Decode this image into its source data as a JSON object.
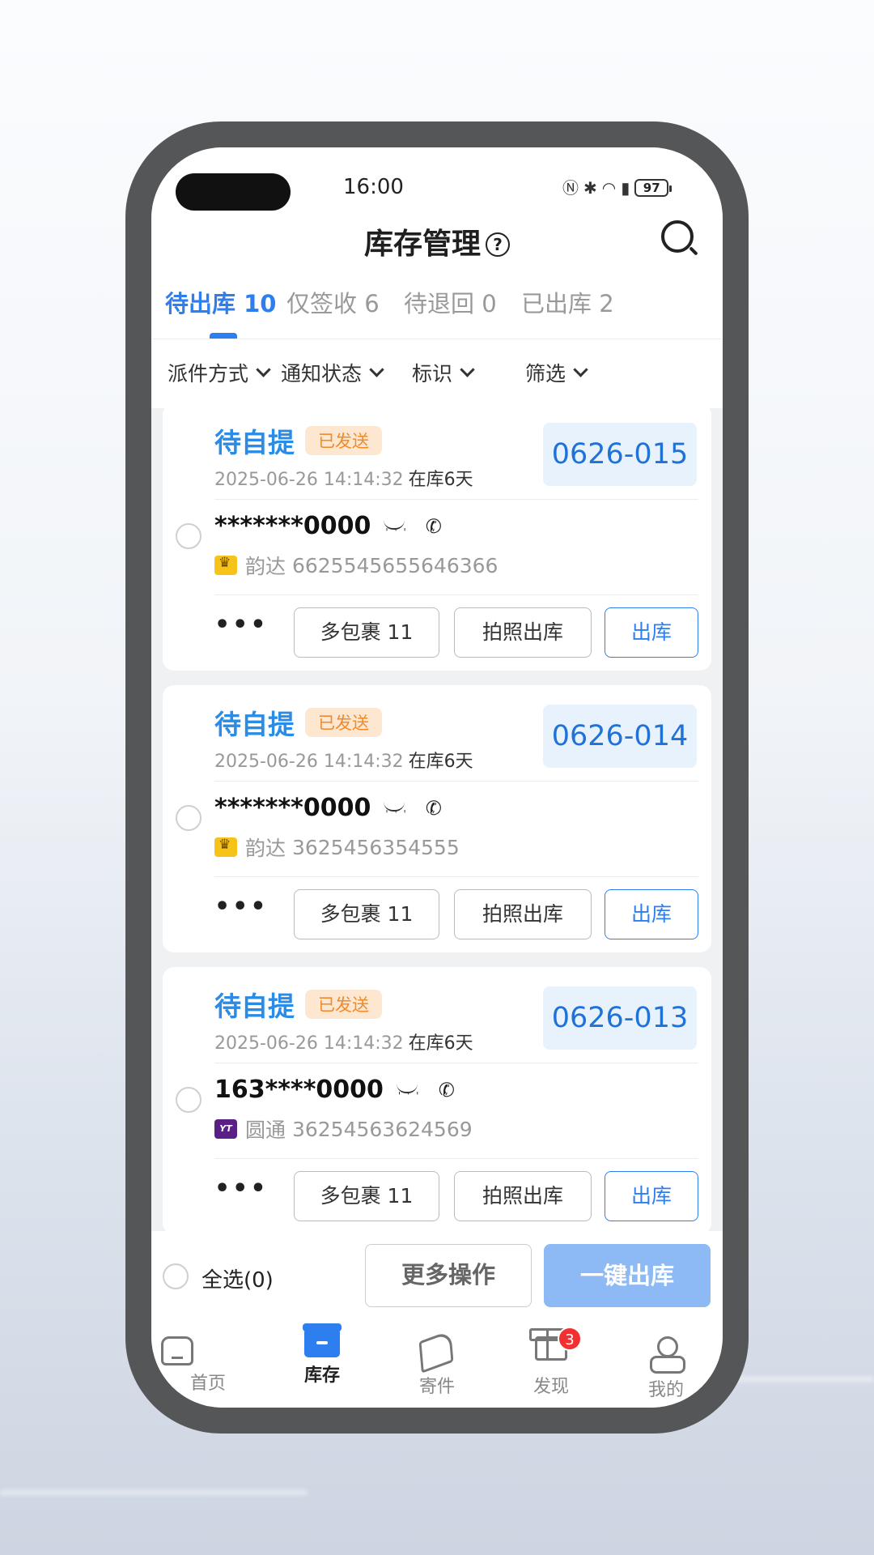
{
  "status_bar": {
    "time": "16:00",
    "battery": "97"
  },
  "header": {
    "title": "库存管理",
    "help_glyph": "?"
  },
  "tabs": [
    {
      "label": "待出库 10"
    },
    {
      "label": "仅签收 6"
    },
    {
      "label": "待退回 0"
    },
    {
      "label": "已出库 2"
    }
  ],
  "filters": [
    {
      "label": "派件方式"
    },
    {
      "label": "通知状态"
    },
    {
      "label": "标识"
    },
    {
      "label": "筛选"
    }
  ],
  "cards": [
    {
      "status": "待自提",
      "badge": "已发送",
      "time": "2025-06-26 14:14:32",
      "days": "在库6天",
      "code": "0626-015",
      "phone": "*******0000",
      "courier": "韵达",
      "tracking": "6625545655646366",
      "courier_icon": "yunda-icon",
      "multi": "多包裹 11",
      "photo": "拍照出库",
      "out": "出库",
      "more": "•••"
    },
    {
      "status": "待自提",
      "badge": "已发送",
      "time": "2025-06-26 14:14:32",
      "days": "在库6天",
      "code": "0626-014",
      "phone": "*******0000",
      "courier": "韵达",
      "tracking": "3625456354555",
      "courier_icon": "yunda-icon",
      "multi": "多包裹 11",
      "photo": "拍照出库",
      "out": "出库",
      "more": "•••"
    },
    {
      "status": "待自提",
      "badge": "已发送",
      "time": "2025-06-26 14:14:32",
      "days": "在库6天",
      "code": "0626-013",
      "phone": "163****0000",
      "courier": "圆通",
      "tracking": "36254563624569",
      "courier_icon": "yto-icon",
      "multi": "多包裹 11",
      "photo": "拍照出库",
      "out": "出库",
      "more": "•••"
    }
  ],
  "bottom_actions": {
    "select_all": "全选(0)",
    "more_ops": "更多操作",
    "one_key": "一键出库"
  },
  "nav": [
    {
      "label": "首页",
      "icon": "home-icon"
    },
    {
      "label": "库存",
      "icon": "inventory-icon"
    },
    {
      "label": "寄件",
      "icon": "send-icon"
    },
    {
      "label": "发现",
      "icon": "gift-icon",
      "badge": "3"
    },
    {
      "label": "我的",
      "icon": "profile-icon"
    }
  ],
  "colors": {
    "accent": "#2d7ff0",
    "status": "#2a8ce6",
    "badge_text": "#f08a2a",
    "badge_bg": "#fde7d1",
    "code_bg": "#e8f2fd",
    "one_key_bg": "#8dbaf5",
    "nav_badge": "#f23030"
  }
}
